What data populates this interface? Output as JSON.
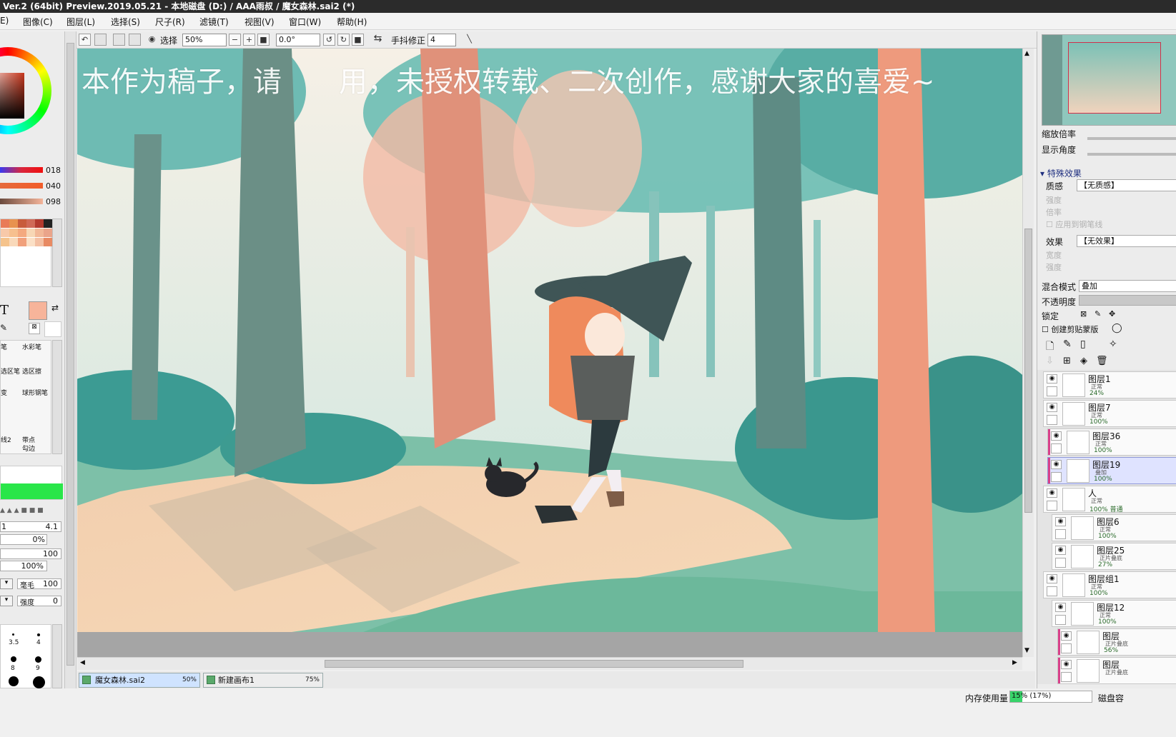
{
  "window": {
    "title": "Ver.2 (64bit) Preview.2019.05.21 - 本地磁盘 (D:) / AAA雨叔 / 魔女森林.sai2 (*)"
  },
  "menu": [
    "E)",
    "图像(C)",
    "图层(L)",
    "选择(S)",
    "尺子(R)",
    "滤镜(T)",
    "视图(V)",
    "窗口(W)",
    "帮助(H)"
  ],
  "toolbar": {
    "select_label": "选择",
    "zoom": "50%",
    "rotation": "0.0°",
    "stabilizer_label": "手抖修正",
    "stabilizer_value": "4"
  },
  "canvas": {
    "watermark": "本作为稿子，请　　用，未授权转载、二次创作，感谢大家的喜爱~"
  },
  "color": {
    "sliders": [
      {
        "value": "018",
        "color": "#d9263d"
      },
      {
        "value": "040",
        "color": "#e56a3c"
      },
      {
        "value": "098",
        "color": "#f4b49a"
      }
    ],
    "main": "#f7b49a",
    "swatches": [
      "#e97b57",
      "#e8924f",
      "#c85c3c",
      "#d06a57",
      "#b33a2e",
      "#222222",
      "#f8c9a9",
      "#f7c08f",
      "#f4a97f",
      "#f7d7b5",
      "#f2b897",
      "#eaa48a",
      "#f5c38c",
      "#f9d9ba",
      "#f1a07b",
      "#fbe0c6",
      "#f4c0a3",
      "#e88a63"
    ]
  },
  "tools": {
    "text_tool": "T",
    "brushes": [
      "笔",
      "水彩笔",
      "选区笔",
      "选区擦",
      "变",
      "球形钢笔",
      "线2",
      "带点",
      "勾边"
    ]
  },
  "brush_settings": {
    "size_left": "1",
    "size_right": "4.1",
    "min_size": "0%",
    "density": "100",
    "percent": "100%",
    "bristle_label": "毫毛",
    "bristle_value": "100",
    "strength_label": "强度",
    "strength_value": "0"
  },
  "brush_sizes": [
    "3.5",
    "4",
    "8",
    "9"
  ],
  "right_panel": {
    "zoom_label": "缩放倍率",
    "angle_label": "显示角度",
    "effects_header": "特殊效果",
    "texture_label": "质感",
    "texture_value": "【无质感】",
    "strength_label": "强度",
    "scale_label": "倍率",
    "apply_pen_label": "应用到钢笔线",
    "effect_label": "效果",
    "effect_value": "【无效果】",
    "width_label": "宽度",
    "intensity_label": "强度",
    "blend_label": "混合模式",
    "blend_value": "叠加",
    "opacity_label": "不透明度",
    "lock_label": "锁定",
    "clip_label": "创建剪贴蒙版"
  },
  "layers": [
    {
      "name": "图层1",
      "mode": "正常",
      "opacity": "24%",
      "selected": false,
      "bar": ""
    },
    {
      "name": "图层7",
      "mode": "正常",
      "opacity": "100%",
      "selected": false,
      "bar": ""
    },
    {
      "name": "图层36",
      "mode": "正常",
      "opacity": "100%",
      "selected": false,
      "bar": "#d9408a"
    },
    {
      "name": "图层19",
      "mode": "叠加",
      "opacity": "100%",
      "selected": true,
      "bar": "#d9408a"
    },
    {
      "name": "人",
      "mode": "正常",
      "opacity": "100% 普通",
      "selected": false,
      "bar": ""
    },
    {
      "name": "图层6",
      "mode": "正常",
      "opacity": "100%",
      "selected": false,
      "bar": ""
    },
    {
      "name": "图层25",
      "mode": "正片叠底",
      "opacity": "27%",
      "selected": false,
      "bar": ""
    },
    {
      "name": "图层组1",
      "mode": "正常",
      "opacity": "100%",
      "selected": false,
      "bar": ""
    },
    {
      "name": "图层12",
      "mode": "正常",
      "opacity": "100%",
      "selected": false,
      "bar": ""
    },
    {
      "name": "图层",
      "mode": "正片叠底",
      "opacity": "56%",
      "selected": false,
      "bar": "#d9408a"
    },
    {
      "name": "图层",
      "mode": "正片叠底",
      "opacity": "",
      "selected": false,
      "bar": "#d9408a"
    }
  ],
  "documents": [
    {
      "name": "魔女森林.sai2",
      "zoom": "50%",
      "active": true
    },
    {
      "name": "新建画布1",
      "zoom": "75%",
      "active": false
    }
  ],
  "status": {
    "memory_label": "内存使用量",
    "memory_value": "15% (17%)",
    "disk_label": "磁盘容"
  }
}
